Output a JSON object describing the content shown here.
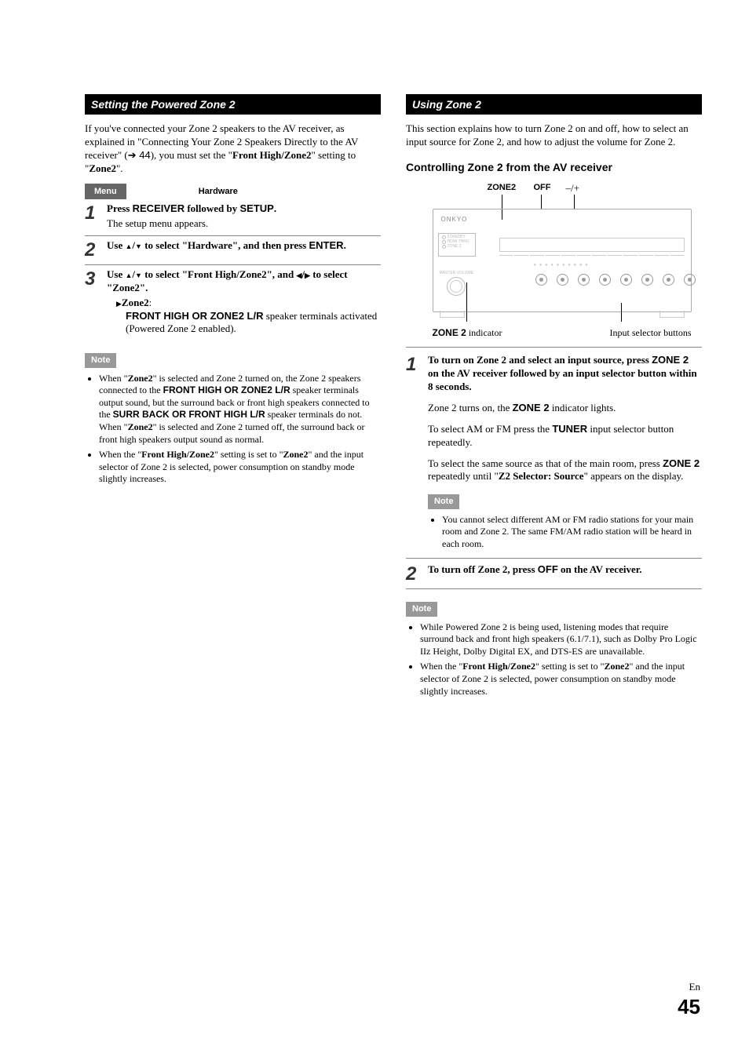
{
  "left": {
    "header": "Setting the Powered Zone 2",
    "intro_pre": "If you've connected your Zone 2 speakers to the AV receiver, as explained in \"Connecting Your Zone 2 Speakers Directly to the AV receiver\" (",
    "intro_ref": "➔ 44",
    "intro_post": "), you must set the \"",
    "intro_bold": "Front High/Zone2",
    "intro_end": "\" setting to \"",
    "intro_bold2": "Zone2",
    "intro_close": "\".",
    "menu_label": "Menu",
    "hardware_label": "Hardware",
    "step1": {
      "num": "1",
      "title_pre": "Press ",
      "title_mid1": "RECEIVER",
      "title_mid2": " followed by ",
      "title_mid3": "SETUP",
      "title_post": ".",
      "detail": "The setup menu appears."
    },
    "step2": {
      "num": "2",
      "pre": "Use ",
      "mid": " to select \"Hardware\", and then press ",
      "enter": "ENTER",
      "post": "."
    },
    "step3": {
      "num": "3",
      "line1_pre": "Use ",
      "line1_mid": " to select \"Front High/Zone2\", and ",
      "line1_post": " to select \"Zone2\".",
      "sub_label": "Zone2",
      "sub_colon": ":",
      "sub_body_bold": "FRONT HIGH OR ZONE2 L/R",
      "sub_body_rest": " speaker terminals activated (Powered Zone 2 enabled)."
    },
    "note_label": "Note",
    "note1_a": "When \"",
    "note1_b": "Zone2",
    "note1_c": "\" is selected and Zone 2 turned on, the Zone 2 speakers connected to the ",
    "note1_d": "FRONT HIGH OR ZONE2 L/R",
    "note1_e": " speaker terminals output sound, but the surround back or front high speakers connected to the ",
    "note1_f": "SURR BACK OR FRONT HIGH L/R",
    "note1_g": " speaker terminals do not. When \"",
    "note1_h": "Zone2",
    "note1_i": "\" is selected and Zone 2 turned off, the surround back or front high speakers output sound as normal.",
    "note2_a": "When the \"",
    "note2_b": "Front High/Zone2",
    "note2_c": "\" setting is set to \"",
    "note2_d": "Zone2",
    "note2_e": "\" and the input selector of Zone 2 is selected, power consumption on standby mode slightly increases."
  },
  "right": {
    "header": "Using Zone 2",
    "intro": "This section explains how to turn Zone 2 on and off, how to select an input source for Zone 2, and how to adjust the volume for Zone 2.",
    "subhead": "Controlling Zone 2 from the AV receiver",
    "fig": {
      "label_zone2": "ZONE2",
      "label_off": "OFF",
      "label_pm": "–/+",
      "brand": "ONKYO",
      "vol_label": "MASTER VOLUME",
      "ind_label_bold": "ZONE 2",
      "ind_label_plain": " indicator",
      "btn_label": "Input selector buttons"
    },
    "step1": {
      "num": "1",
      "title_a": "To turn on Zone 2 and select an input source, press ",
      "title_b": "ZONE 2",
      "title_c": " on the AV receiver followed by an input selector button within 8 seconds.",
      "p1_a": "Zone 2 turns on, the ",
      "p1_b": "ZONE 2",
      "p1_c": " indicator lights.",
      "p2_a": "To select AM or FM press the ",
      "p2_b": "TUNER",
      "p2_c": " input selector button repeatedly.",
      "p3_a": "To select the same source as that of the main room, press ",
      "p3_b": "ZONE 2",
      "p3_c": " repeatedly until \"",
      "p3_d": "Z2 Selector: Source",
      "p3_e": "\" appears on the display.",
      "note_label": "Note",
      "note_text": "You cannot select different AM or FM radio stations for your main room and Zone 2. The same FM/AM radio station will be heard in each room."
    },
    "step2": {
      "num": "2",
      "title_a": "To turn off Zone 2, press ",
      "title_b": "OFF",
      "title_c": " on the AV receiver."
    },
    "note_label": "Note",
    "bn1": "While Powered Zone 2 is being used, listening modes that require surround back and front high speakers (6.1/7.1), such as Dolby Pro Logic IIz Height, Dolby Digital EX, and DTS-ES are unavailable.",
    "bn2_a": "When the \"",
    "bn2_b": "Front High/Zone2",
    "bn2_c": "\" setting is set to \"",
    "bn2_d": "Zone2",
    "bn2_e": "\" and the input selector of Zone 2 is selected, power consumption on standby mode slightly increases."
  },
  "page": {
    "lang": "En",
    "num": "45"
  }
}
